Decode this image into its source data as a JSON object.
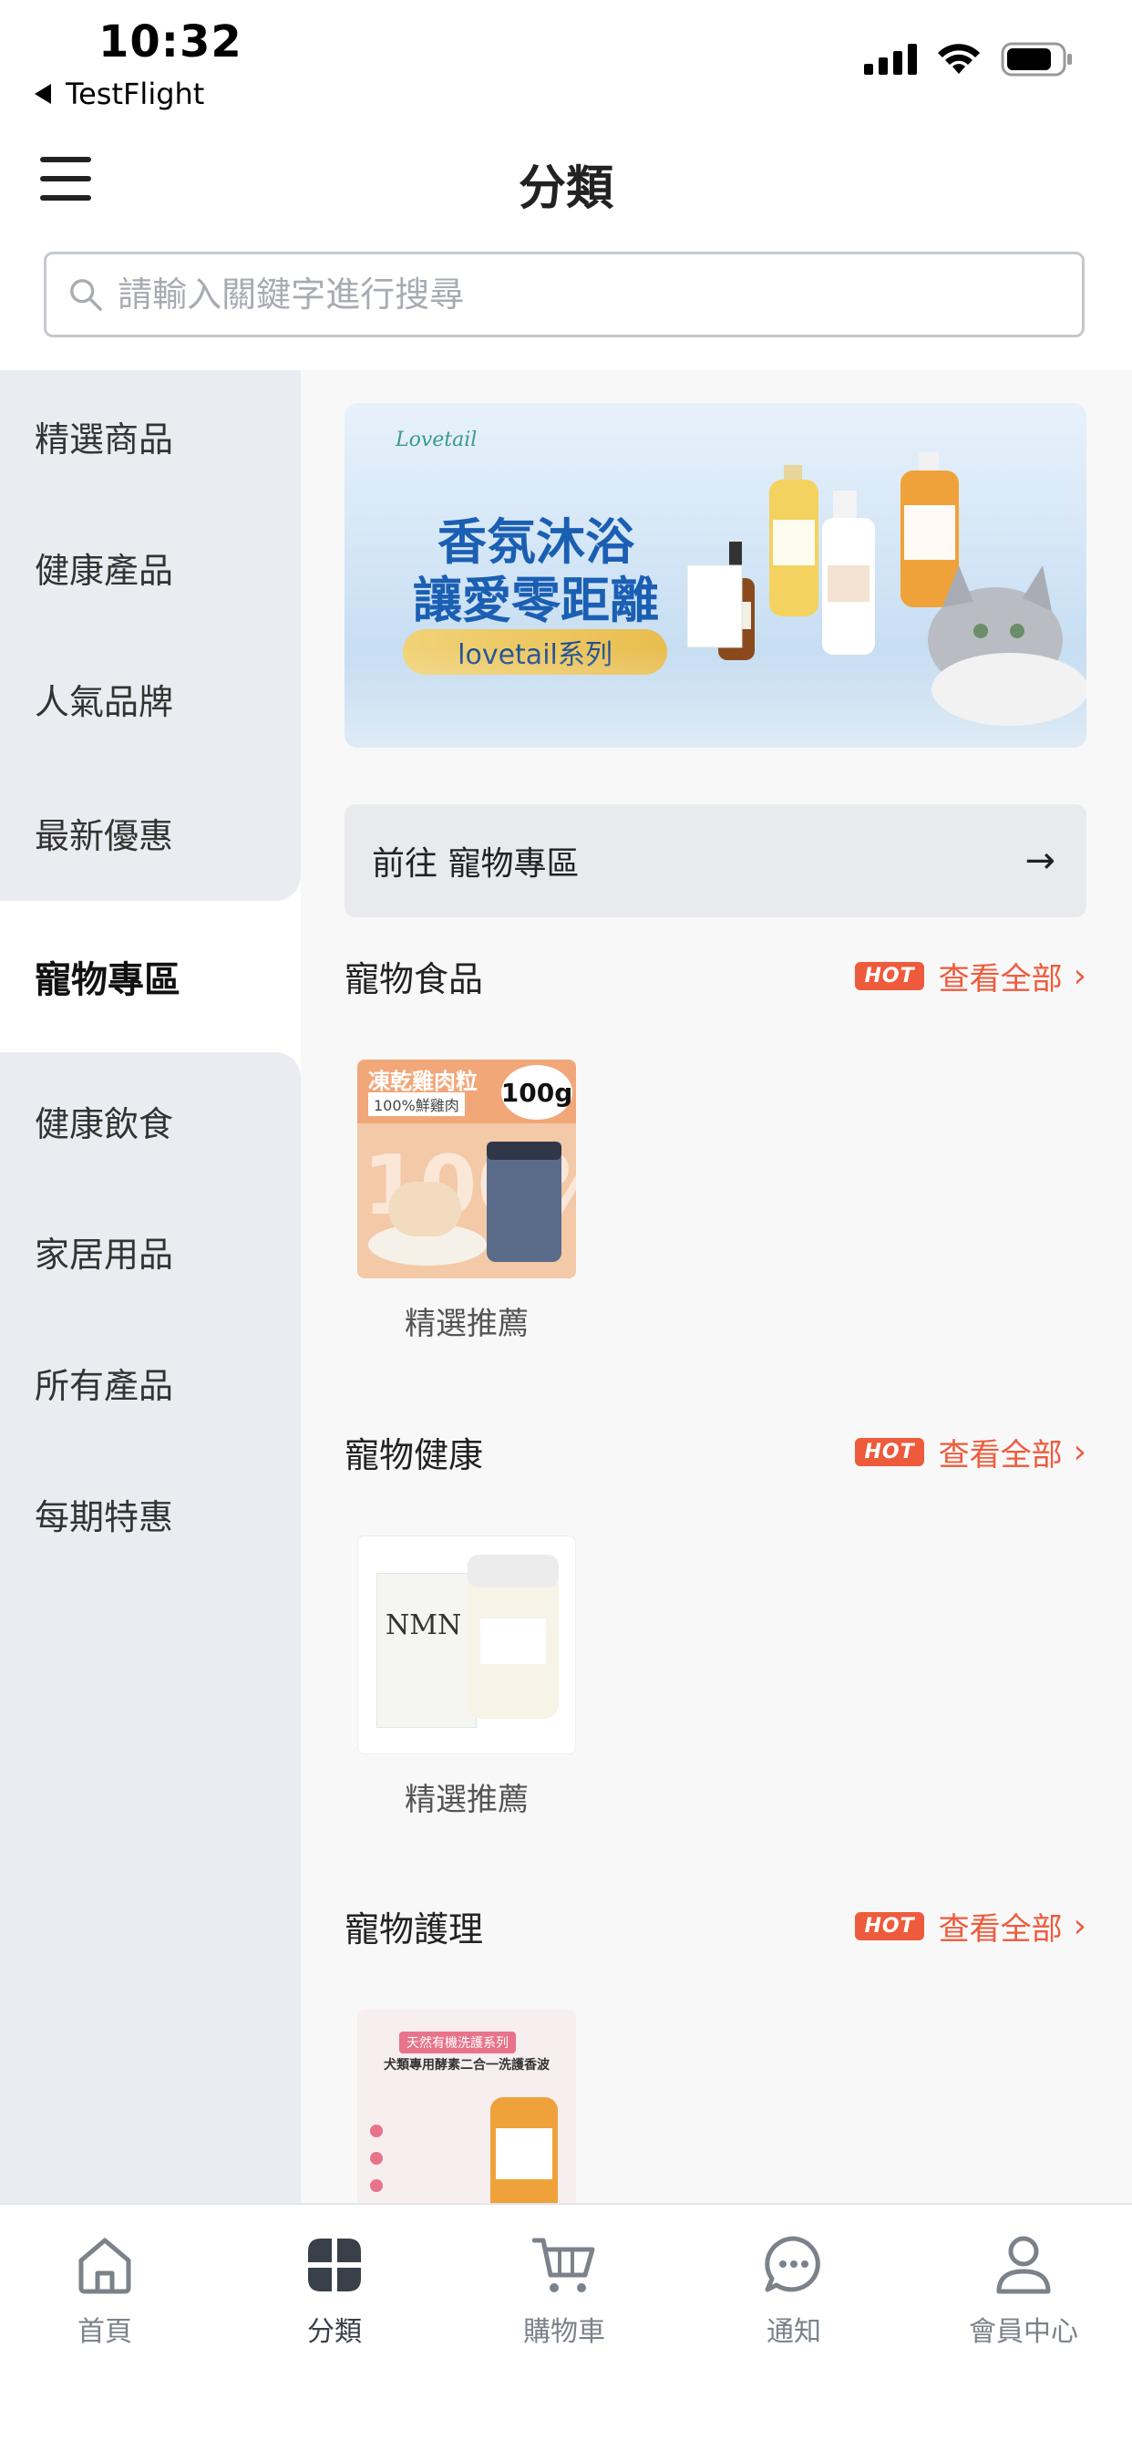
{
  "status_bar": {
    "time": "10:32",
    "back_app": "TestFlight"
  },
  "header": {
    "title": "分類",
    "menu_icon": "hamburger-menu-icon"
  },
  "search": {
    "placeholder": "請輸入關鍵字進行搜尋",
    "value": ""
  },
  "sidebar": {
    "items": [
      {
        "label": "精選商品"
      },
      {
        "label": "健康產品"
      },
      {
        "label": "人氣品牌"
      },
      {
        "label": "最新優惠"
      },
      {
        "label": "寵物專區",
        "active": true
      },
      {
        "label": "健康飲食"
      },
      {
        "label": "家居用品"
      },
      {
        "label": "所有產品"
      },
      {
        "label": "每期特惠"
      }
    ]
  },
  "banner": {
    "logo": "Lovetail",
    "line1": "香氛沐浴",
    "line2": "讓愛零距離",
    "pill": "lovetail系列"
  },
  "goto_link": {
    "label": "前往 寵物專區",
    "arrow": "→"
  },
  "sections": [
    {
      "title": "寵物食品",
      "badge": "HOT",
      "see_all": "查看全部",
      "product": {
        "caption": "精選推薦",
        "image_text_1": "凍乾雞肉粒",
        "image_text_2": "100%鮮雞肉",
        "image_text_3": "100g"
      }
    },
    {
      "title": "寵物健康",
      "badge": "HOT",
      "see_all": "查看全部",
      "product": {
        "caption": "精選推薦",
        "image_text_1": "NMN"
      }
    },
    {
      "title": "寵物護理",
      "badge": "HOT",
      "see_all": "查看全部",
      "product": {
        "caption": "",
        "image_text_1": "天然有機洗護系列",
        "image_text_2": "犬類專用酵素二合一洗護香波"
      }
    }
  ],
  "tabbar": {
    "items": [
      {
        "label": "首頁",
        "icon": "home-icon"
      },
      {
        "label": "分類",
        "icon": "category-grid-icon",
        "active": true
      },
      {
        "label": "購物車",
        "icon": "cart-icon"
      },
      {
        "label": "通知",
        "icon": "chat-bubble-icon"
      },
      {
        "label": "會員中心",
        "icon": "person-icon"
      }
    ]
  },
  "colors": {
    "accent": "#ee5b3c",
    "sidebar_bg": "#eaecf1",
    "banner_text": "#1b5fb3"
  }
}
